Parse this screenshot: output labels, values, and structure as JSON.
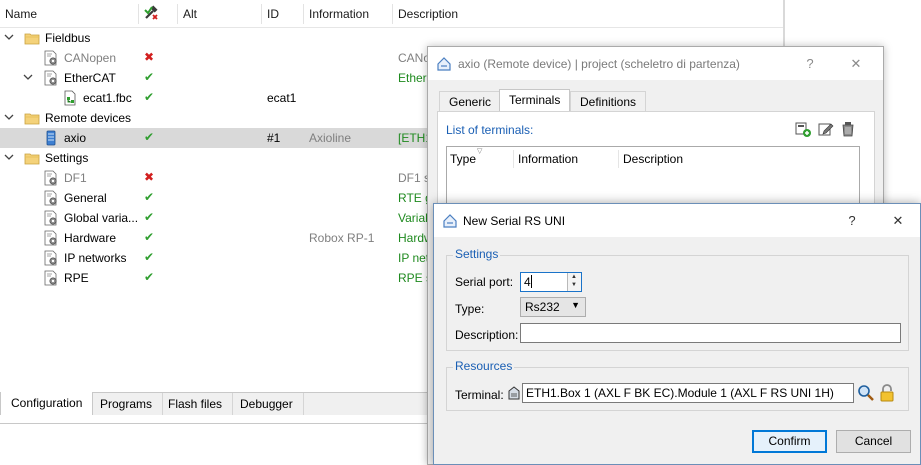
{
  "tree": {
    "columns": {
      "name": "Name",
      "check_icon": "hammer-check-icon",
      "alt": "Alt",
      "id": "ID",
      "information": "Information",
      "description": "Description"
    },
    "rows": [
      {
        "label": "Fieldbus",
        "icon": "folder-icon",
        "expander": "collapse",
        "status": "",
        "id": "",
        "information": "",
        "description": "",
        "dim": false
      },
      {
        "label": "CANopen",
        "icon": "config-icon",
        "expander": "",
        "status": "error",
        "id": "",
        "information": "",
        "description": "CANop",
        "dim": true
      },
      {
        "label": "EtherCAT",
        "icon": "config-icon",
        "expander": "collapse",
        "status": "ok",
        "id": "",
        "information": "",
        "description": "EtherC",
        "dim": false
      },
      {
        "label": "ecat1.fbc",
        "icon": "fieldbus-file-icon",
        "expander": "",
        "status": "ok",
        "id": "ecat1",
        "information": "",
        "description": "",
        "dim": false
      },
      {
        "label": "Remote devices",
        "icon": "folder-icon",
        "expander": "collapse",
        "status": "",
        "id": "",
        "information": "",
        "description": "",
        "dim": false
      },
      {
        "label": "axio",
        "icon": "device-icon",
        "expander": "",
        "status": "ok",
        "id": "#1",
        "information": "Axioline",
        "description": "[ETH1",
        "dim": false,
        "selected": true
      },
      {
        "label": "Settings",
        "icon": "folder-icon",
        "expander": "collapse",
        "status": "",
        "id": "",
        "information": "",
        "description": "",
        "dim": false
      },
      {
        "label": "DF1",
        "icon": "config-icon",
        "expander": "",
        "status": "error",
        "id": "",
        "information": "",
        "description": "DF1 sp",
        "dim": true
      },
      {
        "label": "General",
        "icon": "config-icon",
        "expander": "",
        "status": "ok",
        "id": "",
        "information": "",
        "description": "RTE ge",
        "dim": false
      },
      {
        "label": "Global varia...",
        "icon": "config-icon",
        "expander": "",
        "status": "ok",
        "id": "",
        "information": "",
        "description": "Variab",
        "dim": false
      },
      {
        "label": "Hardware",
        "icon": "config-icon",
        "expander": "",
        "status": "ok",
        "id": "",
        "information": "Robox RP-1",
        "description": "Hardw",
        "dim": false
      },
      {
        "label": "IP networks",
        "icon": "config-icon",
        "expander": "",
        "status": "ok",
        "id": "",
        "information": "",
        "description": "IP net",
        "dim": false
      },
      {
        "label": "RPE",
        "icon": "config-icon",
        "expander": "",
        "status": "ok",
        "id": "",
        "information": "",
        "description": "RPE sp",
        "dim": false
      }
    ]
  },
  "bottom_tabs": [
    "Configuration",
    "Programs",
    "Flash files",
    "Debugger"
  ],
  "remote_dialog": {
    "title": "axio (Remote device) | project (scheletro di partenza)",
    "help": "?",
    "close": "✕",
    "tabs": [
      "Generic",
      "Terminals",
      "Definitions"
    ],
    "active_tab": "Terminals",
    "list_label": "List of terminals:",
    "columns": [
      "Type",
      "Information",
      "Description"
    ]
  },
  "serial_dialog": {
    "title": "New Serial RS UNI",
    "help": "?",
    "close": "✕",
    "settings_label": "Settings",
    "serial_port_label": "Serial  port:",
    "serial_port_value": "4",
    "type_label": "Type:",
    "type_value": "Rs232",
    "description_label": "Description:",
    "description_value": "",
    "resources_label": "Resources",
    "terminal_label": "Terminal:",
    "terminal_value": "ETH1.Box 1 (AXL F BK EC).Module 1 (AXL F RS UNI 1H)",
    "confirm": "Confirm",
    "cancel": "Cancel"
  },
  "colors": {
    "ok": "#2f9e2f",
    "error": "#d21f1f",
    "link_blue": "#1a5fb4",
    "description_green": "#1f8a1f",
    "selection": "#d9d9d9"
  }
}
